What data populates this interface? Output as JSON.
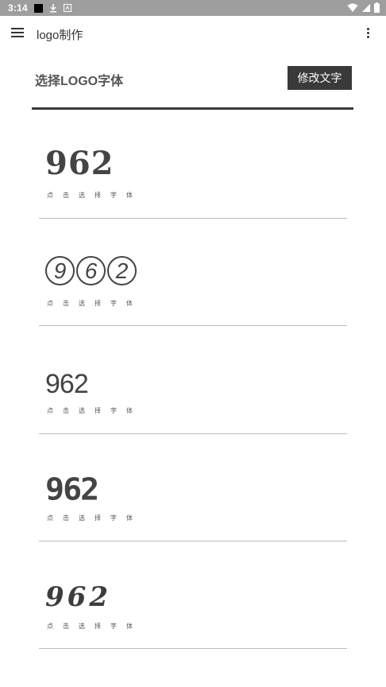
{
  "status_bar": {
    "time": "3:14"
  },
  "app_bar": {
    "title": "logo制作"
  },
  "header": {
    "title": "选择LOGO字体",
    "edit_button": "修改文字"
  },
  "fonts": [
    {
      "sample": "962",
      "hint": "点击选择字体"
    },
    {
      "sample": [
        "9",
        "6",
        "2"
      ],
      "hint": "点击选择字体"
    },
    {
      "sample": "962",
      "hint": "点击选择字体"
    },
    {
      "sample": "962",
      "hint": "点击选择字体"
    },
    {
      "sample": "962",
      "hint": "点击选择字体"
    }
  ],
  "colors": {
    "status_bar_bg": "#9e9e9e",
    "button_bg": "#3a3a3a",
    "divider": "#3a3a3a"
  }
}
